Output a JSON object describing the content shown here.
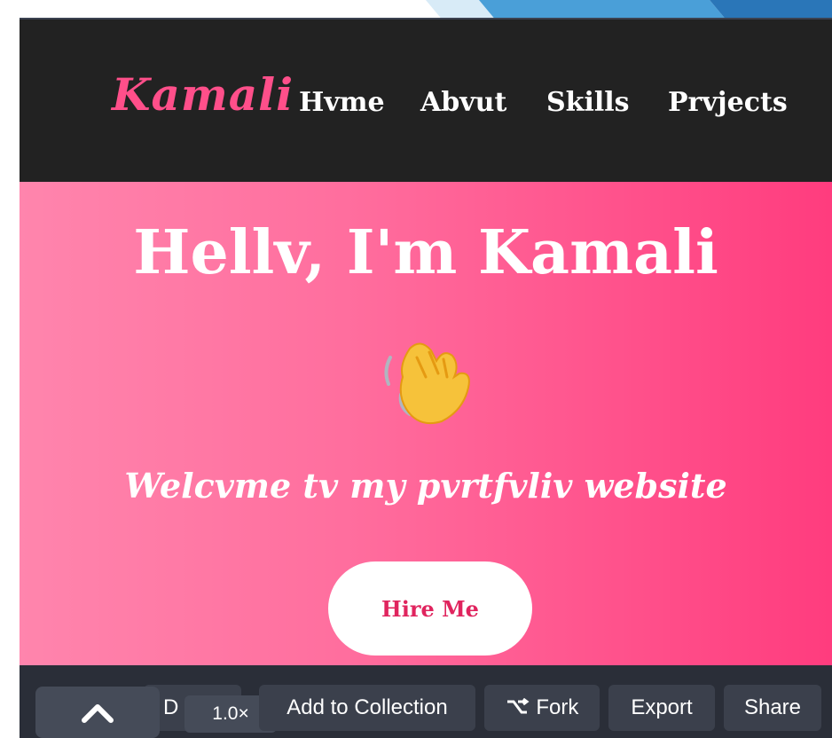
{
  "brand": {
    "logo": "Kamali",
    "color": "#ff4f8a"
  },
  "nav": {
    "items": [
      "Hvme",
      "Abvut",
      "Skills",
      "Prvjects"
    ]
  },
  "hero": {
    "title": "Hellv, I'm Kamali",
    "emoji": "waving-hand-icon",
    "subtitle": "Welcvme tv my pvrtfvliv website",
    "cta": "Hire Me",
    "gradient": [
      "#ff85ad",
      "#ff3c7e"
    ]
  },
  "toolbar": {
    "collapse_icon": "chevron-up-icon",
    "truncated_label": "D",
    "zoom": "1.0×",
    "add_to_collection": "Add to Collection",
    "fork": "Fork",
    "fork_icon": "fork-icon",
    "export": "Export",
    "share": "Share"
  }
}
